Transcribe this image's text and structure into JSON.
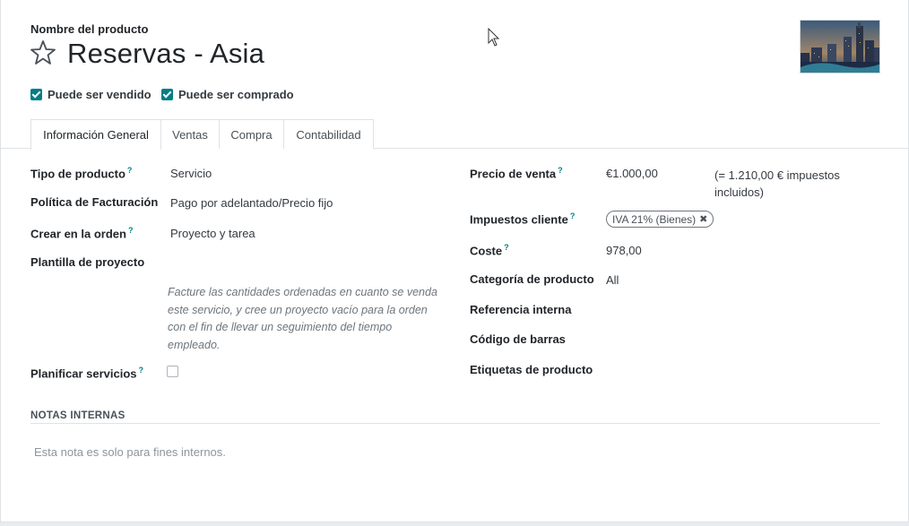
{
  "header": {
    "name_label": "Nombre del producto",
    "title": "Reservas - Asia",
    "can_be_sold": "Puede ser vendido",
    "can_be_purchased": "Puede ser comprado"
  },
  "tabs": [
    {
      "label": "Información General"
    },
    {
      "label": "Ventas"
    },
    {
      "label": "Compra"
    },
    {
      "label": "Contabilidad"
    }
  ],
  "left": {
    "product_type_label": "Tipo de producto",
    "product_type_value": "Servicio",
    "invoicing_policy_label": "Política de Facturación",
    "invoicing_policy_value": "Pago por adelantado/Precio fijo",
    "create_on_order_label": "Crear en la orden",
    "create_on_order_value": "Proyecto y tarea",
    "project_template_label": "Plantilla de proyecto",
    "help_text": "Facture las cantidades ordenadas en cuanto se venda este servicio, y cree un proyecto vacío para la orden con el fin de llevar un seguimiento del tiempo empleado.",
    "plan_services_label": "Planificar servicios"
  },
  "right": {
    "sales_price_label": "Precio de venta",
    "sales_price_value": "€1.000,00",
    "sales_price_taxed": "(= 1.210,00 € impuestos incluidos)",
    "customer_taxes_label": "Impuestos cliente",
    "customer_taxes_tag": "IVA 21% (Bienes)",
    "cost_label": "Coste",
    "cost_value": "978,00",
    "category_label": "Categoría de producto",
    "category_value": "All",
    "internal_ref_label": "Referencia interna",
    "barcode_label": "Código de barras",
    "tags_label": "Etiquetas de producto"
  },
  "notes": {
    "title": "NOTAS INTERNAS",
    "placeholder": "Esta nota es solo para fines internos."
  },
  "colors": {
    "accent": "#017e84"
  }
}
